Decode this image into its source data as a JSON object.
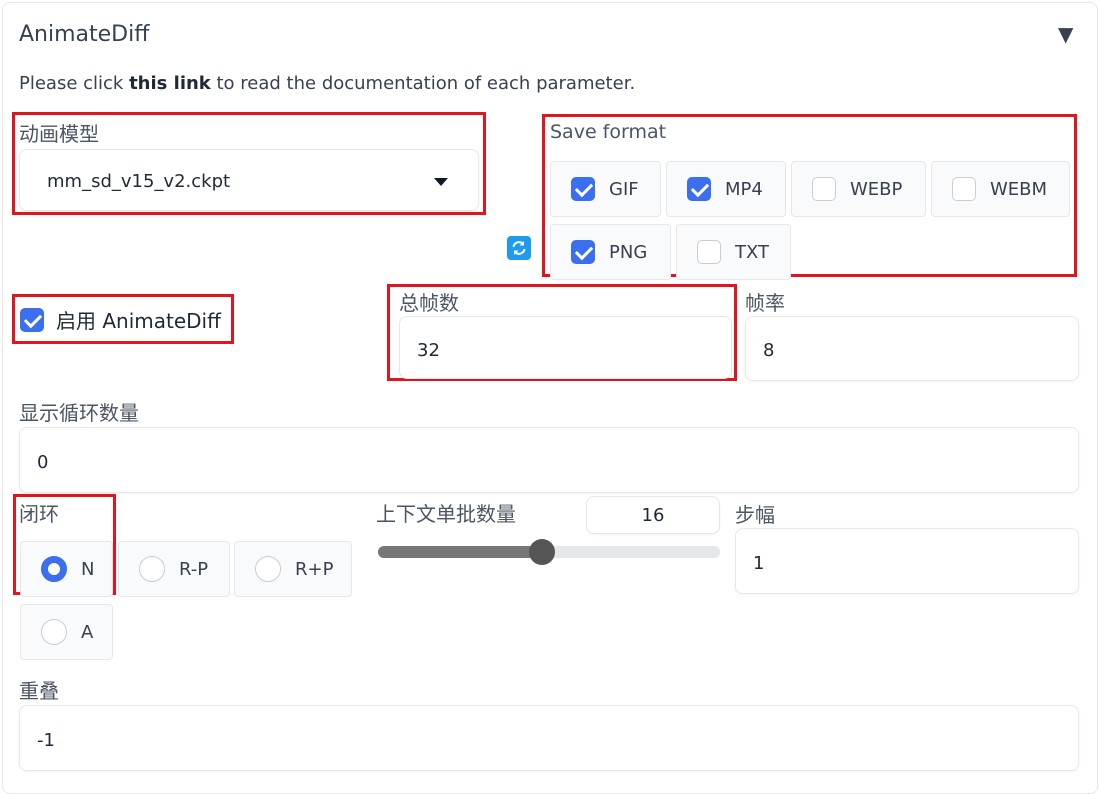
{
  "header": {
    "title": "AnimateDiff",
    "collapse_glyph": "▼"
  },
  "description": {
    "prefix": "Please click ",
    "link": "this link",
    "suffix": " to read the documentation of each parameter."
  },
  "model": {
    "label": "动画模型",
    "value": "mm_sd_v15_v2.ckpt"
  },
  "save_format": {
    "label": "Save format",
    "options": [
      {
        "label": "GIF",
        "checked": true
      },
      {
        "label": "MP4",
        "checked": true
      },
      {
        "label": "WEBP",
        "checked": false
      },
      {
        "label": "WEBM",
        "checked": false
      },
      {
        "label": "PNG",
        "checked": true
      },
      {
        "label": "TXT",
        "checked": false
      }
    ]
  },
  "enable": {
    "label": "启用 AnimateDiff",
    "checked": true
  },
  "total_frames": {
    "label": "总帧数",
    "value": "32"
  },
  "fps": {
    "label": "帧率",
    "value": "8"
  },
  "loop_count": {
    "label": "显示循环数量",
    "value": "0"
  },
  "closed_loop": {
    "label": "闭环",
    "options": [
      {
        "label": "N",
        "selected": true
      },
      {
        "label": "R-P",
        "selected": false
      },
      {
        "label": "R+P",
        "selected": false
      },
      {
        "label": "A",
        "selected": false
      }
    ]
  },
  "context_batch": {
    "label": "上下文单批数量",
    "value": "16",
    "fraction": 0.48
  },
  "stride": {
    "label": "步幅",
    "value": "1"
  },
  "overlap": {
    "label": "重叠",
    "value": "-1"
  },
  "colors": {
    "accent": "#3b6ff0",
    "highlight": "#e0161f",
    "refresh": "#1e9bf0"
  },
  "icons": {
    "refresh": "refresh-icon",
    "dropdown": "caret-down-icon"
  }
}
